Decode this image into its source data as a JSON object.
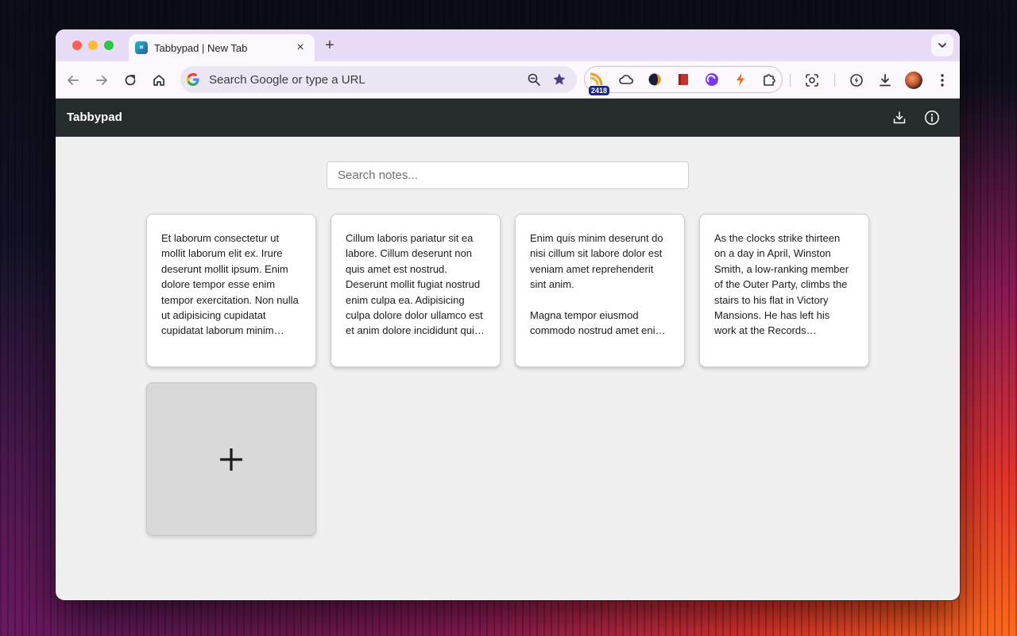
{
  "browser": {
    "tab_title": "Tabbypad | New Tab",
    "tab_favicon_text": "⌗",
    "omnibox_placeholder": "Search Google or type a URL",
    "extension_badge": "2418"
  },
  "app": {
    "title": "Tabbypad",
    "search_placeholder": "Search notes...",
    "notes": [
      {
        "text": "Et laborum consectetur ut mollit laborum elit ex. Irure deserunt mollit ipsum. Enim dolore tempor esse enim tempor exercitation. Non nulla ut adipisicing cupidatat cupidatat laborum minim occaecat laborum Lorem. Veniam"
      },
      {
        "text": "Cillum laboris pariatur sit ea labore. Cillum deserunt non quis amet est nostrud. Deserunt mollit fugiat nostrud enim culpa ea. Adipisicing culpa dolore dolor ullamco est et anim dolore incididunt quis aliquip amet. Enim sunt aliqua"
      },
      {
        "text": "Enim quis minim deserunt do nisi cillum sit labore dolor est veniam amet reprehenderit sint anim.\n\nMagna tempor eiusmod commodo nostrud amet enim est magna esse sunt nostrud"
      },
      {
        "text": "As the clocks strike thirteen on a day in April, Winston Smith, a low-ranking member of the Outer Party, climbs the stairs to his flat in Victory Mansions. He has left his work at the Records Department early in order to"
      }
    ],
    "add_note_symbol": "+"
  }
}
